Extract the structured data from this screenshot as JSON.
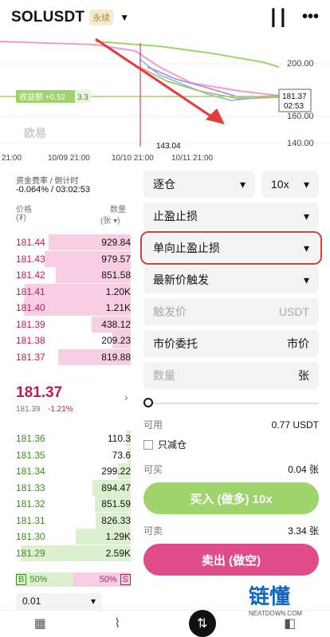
{
  "header": {
    "pair": "SOLUSDT",
    "tag": "永续"
  },
  "chart": {
    "price_labels": [
      "200.00",
      "160.00",
      "140.00"
    ],
    "badge": "收益额 +0.52",
    "badge_num": "3.3",
    "current": "181.37",
    "timer": "02:53",
    "low_mark": "143.04",
    "dates": [
      "21:00",
      "10/09 21:00",
      "10/10 21:00",
      "10/11 21:00"
    ],
    "watermark": "欧易"
  },
  "book": {
    "funding_label": "资金费率 / 倒计时",
    "funding_value": "-0.064% / 03:02:53",
    "col_price": "价格",
    "col_price_unit": "(₮)",
    "col_qty": "数量",
    "col_qty_unit": "(张 ▾)",
    "asks": [
      [
        "181.44",
        "929.84"
      ],
      [
        "181.43",
        "979.57"
      ],
      [
        "181.42",
        "851.58"
      ],
      [
        "181.41",
        "1.20K"
      ],
      [
        "181.40",
        "1.21K"
      ],
      [
        "181.39",
        "438.12"
      ],
      [
        "181.38",
        "209.23"
      ],
      [
        "181.37",
        "819.88"
      ]
    ],
    "last": "181.37",
    "last_sub": "181.39",
    "last_change": "-1.21%",
    "bids": [
      [
        "181.36",
        "110.3"
      ],
      [
        "181.35",
        "73.6"
      ],
      [
        "181.34",
        "299.22"
      ],
      [
        "181.33",
        "894.47"
      ],
      [
        "181.32",
        "851.59"
      ],
      [
        "181.31",
        "826.33"
      ],
      [
        "181.30",
        "1.29K"
      ],
      [
        "181.29",
        "2.59K"
      ]
    ],
    "b_label": "B",
    "b_pct": "50%",
    "s_pct": "50%",
    "s_label": "S",
    "tick": "0.01"
  },
  "panel": {
    "margin_mode": "逐仓",
    "leverage": "10x",
    "order_type": "止盈止损",
    "sub_type": "单向止盈止损",
    "trigger": "最新价触发",
    "trigger_placeholder": "触发价",
    "trigger_unit": "USDT",
    "exec_type": "市价委托",
    "exec_value": "市价",
    "qty_placeholder": "数量",
    "qty_unit": "张",
    "avail_label": "可用",
    "avail_value": "0.77 USDT",
    "reduce_only": "只减仓",
    "buy_label": "可买",
    "buy_value": "0.04 张",
    "buy_btn": "买入 (做多) 10x",
    "sell_label": "可卖",
    "sell_value": "3.34 张",
    "sell_btn": "卖出 (做空)"
  },
  "watermark_brand": {
    "title": "链懂",
    "sub": "NEATDOWN.COM"
  },
  "colors": {
    "ask": "#f9cde3",
    "bid": "#dcefcf",
    "highlight": "#e23b3b"
  }
}
